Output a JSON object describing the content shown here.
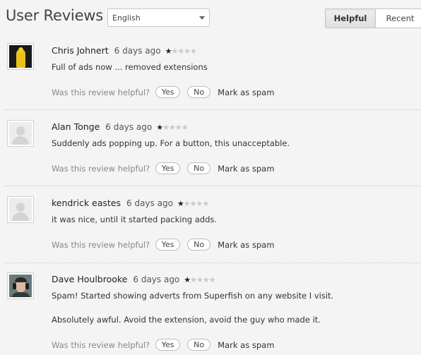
{
  "header": {
    "title": "User Reviews",
    "language_selected": "English",
    "sort_options": [
      "Helpful",
      "Recent"
    ],
    "active_sort": "Helpful"
  },
  "helpful_prompt": "Was this review helpful?",
  "yes_label": "Yes",
  "no_label": "No",
  "spam_label": "Mark as spam",
  "reviews": [
    {
      "author": "Chris Johnert",
      "date": "6 days ago",
      "rating": 1,
      "max_rating": 5,
      "avatar": "yellow-costume-photo",
      "lines": [
        "Full of ads now ... removed extensions"
      ]
    },
    {
      "author": "Alan Tonge",
      "date": "6 days ago",
      "rating": 1,
      "max_rating": 5,
      "avatar": "default-silhouette",
      "lines": [
        "Suddenly ads popping up. For a button, this unacceptable."
      ]
    },
    {
      "author": "kendrick eastes",
      "date": "6 days ago",
      "rating": 1,
      "max_rating": 5,
      "avatar": "default-silhouette",
      "lines": [
        "it was nice, until it started packing adds."
      ]
    },
    {
      "author": "Dave Houlbrooke",
      "date": "6 days ago",
      "rating": 1,
      "max_rating": 5,
      "avatar": "headphones-portrait-photo",
      "lines": [
        "Spam! Started showing adverts from Superfish on any website I visit.",
        "Absolutely awful. Avoid the extension, avoid the guy who made it."
      ]
    }
  ]
}
